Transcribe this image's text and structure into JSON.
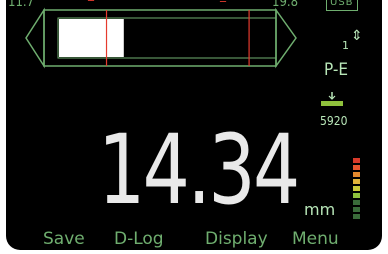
{
  "top_bar": {
    "left_value": "11.7",
    "right_value": "19.8",
    "usb_label": "USB"
  },
  "gauge": {
    "fill_start_fraction": 0.0,
    "fill_end_fraction": 0.3,
    "marker_a_fraction": 0.22,
    "marker_b_fraction": 0.88,
    "frame_color": "#6fae6f",
    "fill_color": "#ffffff",
    "marker_color": "#e53b2e"
  },
  "status": {
    "probe_number": "1",
    "probe_arrows": "⇕",
    "mode": "P-E",
    "velocity": "5920"
  },
  "measurement": {
    "value": "14.34",
    "unit": "mm"
  },
  "signal_meter": {
    "segments": [
      "#3a6b3a",
      "#3a6b3a",
      "#3a6b3a",
      "#8fc13c",
      "#c9c93a",
      "#e0b33a",
      "#e58a2e",
      "#e5542e",
      "#d83a2a"
    ]
  },
  "softkeys": [
    "Save",
    "D-Log",
    "Display",
    "Menu"
  ],
  "colors": {
    "background": "#000000",
    "text_green": "#6fae6f",
    "text_light_green": "#b8e6b8",
    "reading": "#e9e9e9"
  }
}
